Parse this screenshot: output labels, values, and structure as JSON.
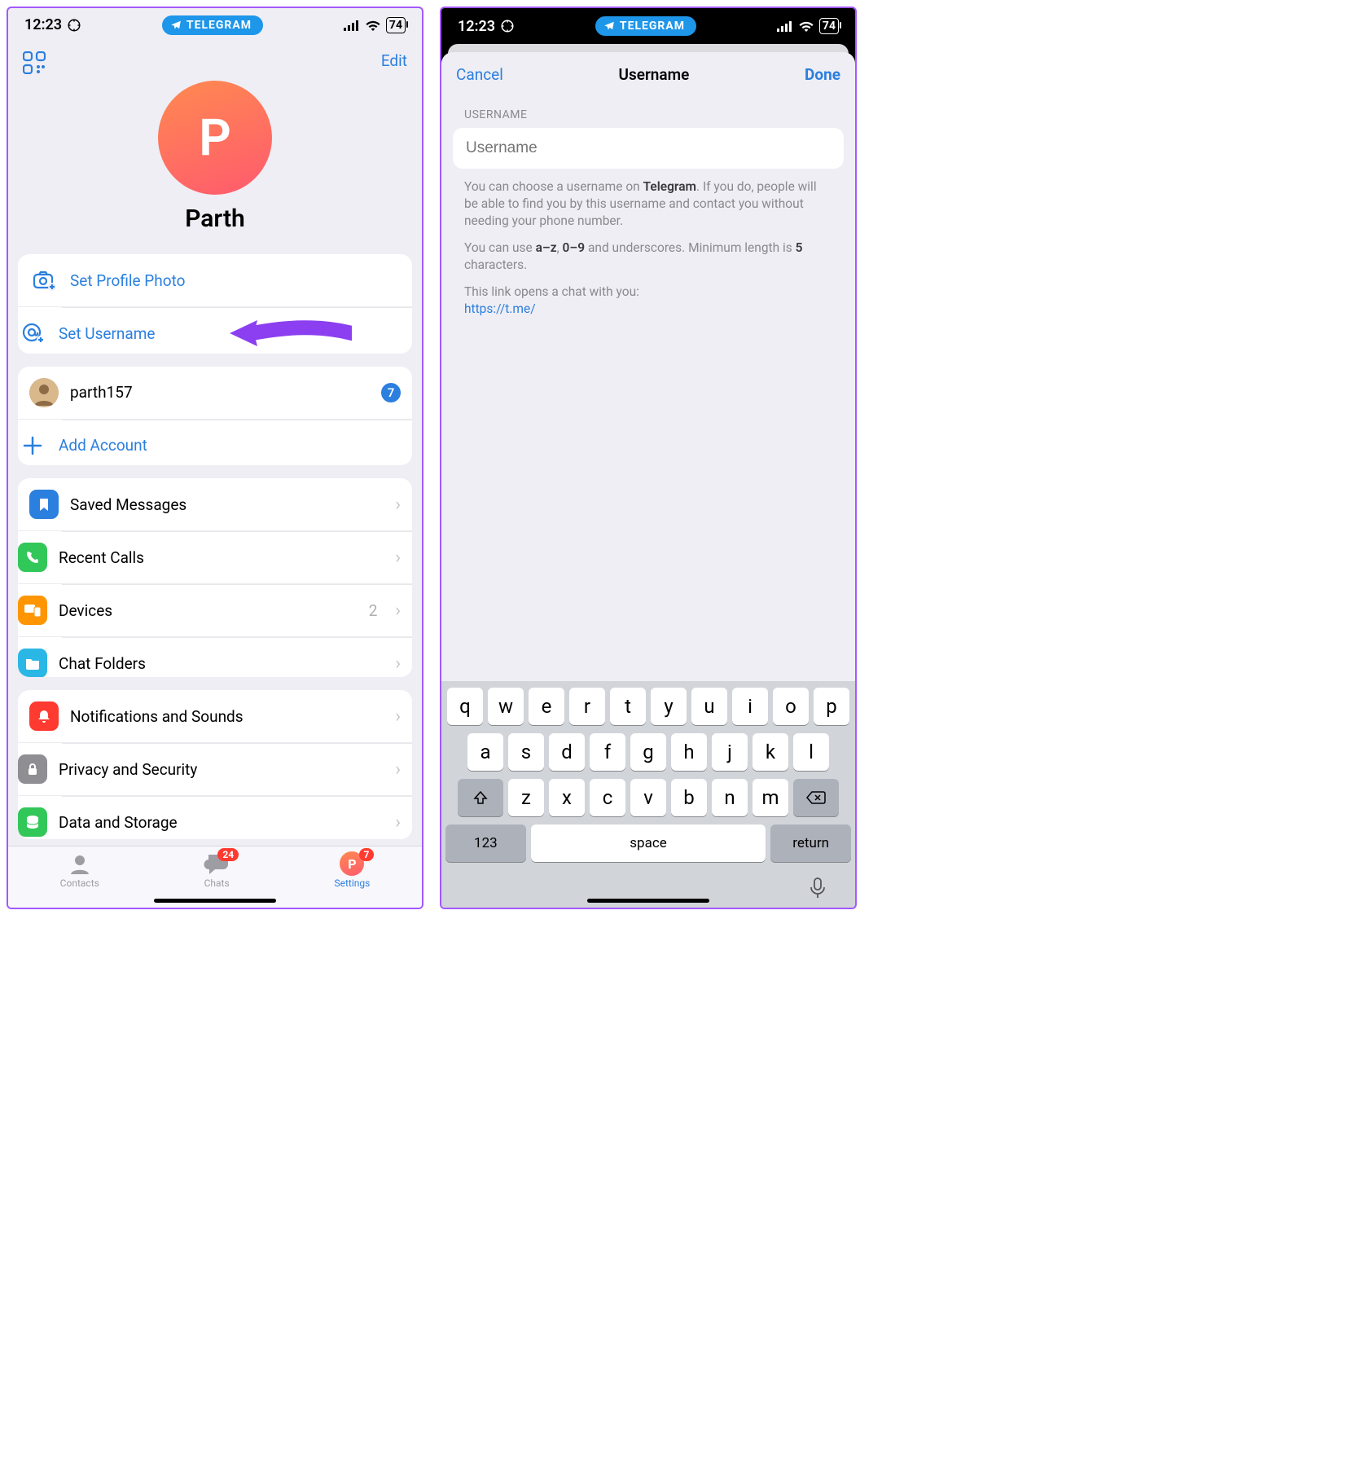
{
  "status": {
    "time": "12:23",
    "pill": "TELEGRAM",
    "battery": "74"
  },
  "left": {
    "edit": "Edit",
    "profile": {
      "initial": "P",
      "name": "Parth"
    },
    "actions": {
      "set_photo": "Set Profile Photo",
      "set_username": "Set Username"
    },
    "accounts": {
      "current": "parth157",
      "current_badge": "7",
      "add": "Add Account"
    },
    "menu1": {
      "saved": "Saved Messages",
      "calls": "Recent Calls",
      "devices": "Devices",
      "devices_count": "2",
      "folders": "Chat Folders"
    },
    "menu2": {
      "notifications": "Notifications and Sounds",
      "privacy": "Privacy and Security",
      "data": "Data and Storage"
    },
    "tabs": {
      "contacts": "Contacts",
      "chats": "Chats",
      "chats_badge": "24",
      "settings": "Settings",
      "settings_badge": "7"
    }
  },
  "right": {
    "cancel": "Cancel",
    "title": "Username",
    "done": "Done",
    "section_label": "USERNAME",
    "placeholder": "Username",
    "help1_a": "You can choose a username on ",
    "help1_b": "Telegram",
    "help1_c": ". If you do, people will be able to find you by this username and contact you without needing your phone number.",
    "help2_a": "You can use ",
    "help2_b": "a–z",
    "help2_c": ", ",
    "help2_d": "0–9",
    "help2_e": " and underscores. Minimum length is ",
    "help2_f": "5",
    "help2_g": " characters.",
    "help3": "This link opens a chat with you:",
    "link": "https://t.me/",
    "keys_r1": [
      "q",
      "w",
      "e",
      "r",
      "t",
      "y",
      "u",
      "i",
      "o",
      "p"
    ],
    "keys_r2": [
      "a",
      "s",
      "d",
      "f",
      "g",
      "h",
      "j",
      "k",
      "l"
    ],
    "keys_r3": [
      "z",
      "x",
      "c",
      "v",
      "b",
      "n",
      "m"
    ],
    "key_123": "123",
    "key_space": "space",
    "key_return": "return"
  }
}
